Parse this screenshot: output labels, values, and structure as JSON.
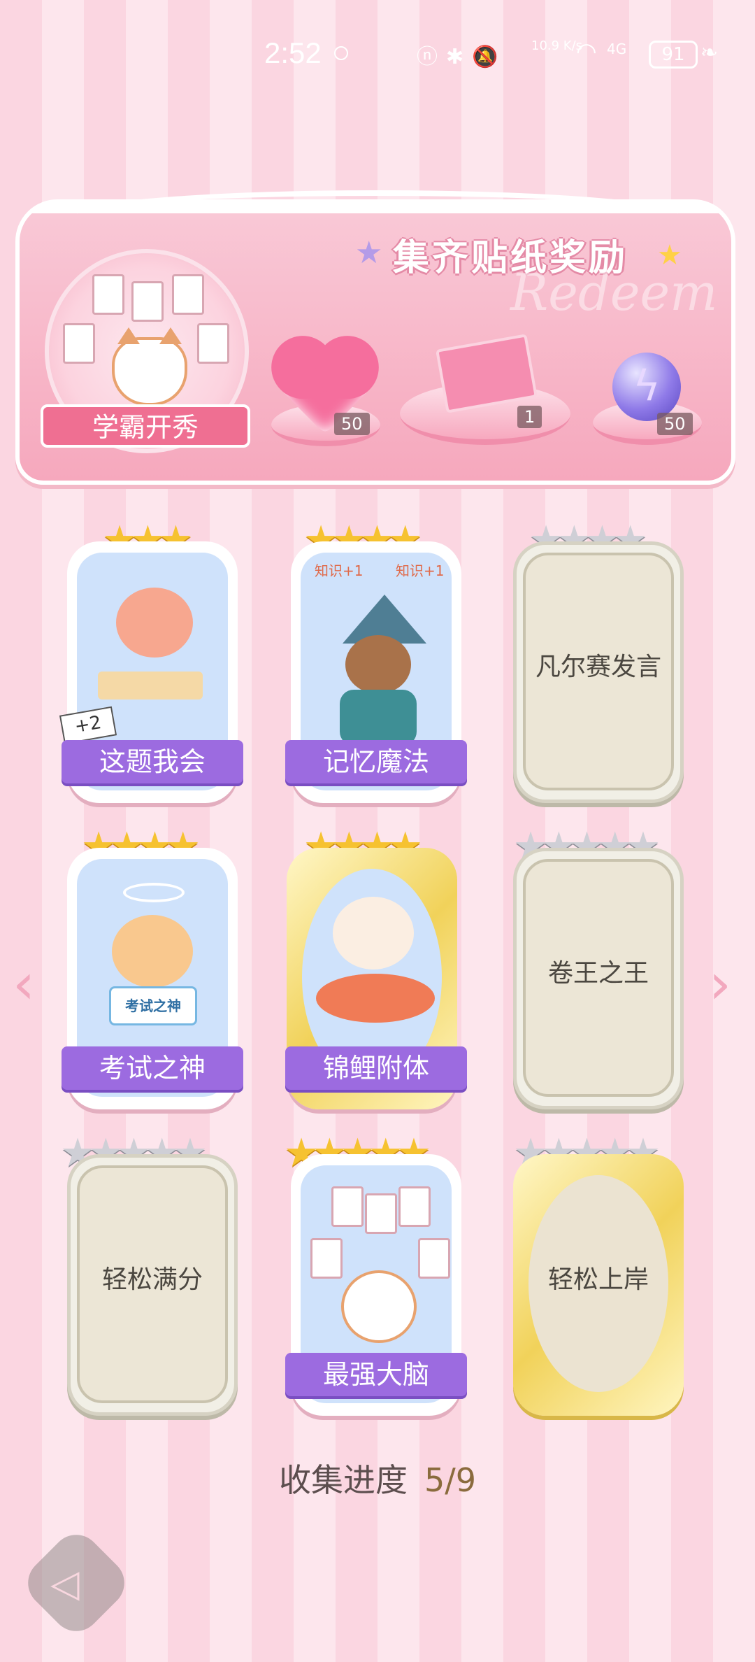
{
  "status_bar": {
    "time": "2:52",
    "net_speed": "10.9\nK/s",
    "network": "4G",
    "battery": "91"
  },
  "banner": {
    "title": "集齐贴纸奖励",
    "ghost_text": "Redeem",
    "medal_label": "学霸开秀",
    "rewards": [
      {
        "icon": "heart-gem-icon",
        "count": "50"
      },
      {
        "icon": "gift-box-icon",
        "count": "1"
      },
      {
        "icon": "energy-orb-icon",
        "count": "50"
      }
    ]
  },
  "stickers": [
    {
      "name": "这题我会",
      "stars": 3,
      "collected": true,
      "badge": "+2"
    },
    {
      "name": "记忆魔法",
      "stars": 4,
      "collected": true
    },
    {
      "name": "凡尔赛发言",
      "stars": 4,
      "collected": false
    },
    {
      "name": "考试之神",
      "stars": 4,
      "collected": true
    },
    {
      "name": "锦鲤附体",
      "stars": 4,
      "collected": true
    },
    {
      "name": "卷王之王",
      "stars": 5,
      "collected": false
    },
    {
      "name": "轻松满分",
      "stars": 5,
      "collected": false
    },
    {
      "name": "最强大脑",
      "stars": 5,
      "collected": true
    },
    {
      "name": "轻松上岸",
      "stars": 5,
      "collected": false
    }
  ],
  "sticker_text": {
    "exam_sign": "考试之神",
    "knowledge_tag": "知识+1"
  },
  "progress": {
    "label": "收集进度",
    "value": "5/9"
  },
  "colors": {
    "accent_pink": "#f6a8bd",
    "plate_purple": "#9c6be0",
    "star_gold": "#f6c230",
    "star_silver": "#cfcfd6"
  }
}
